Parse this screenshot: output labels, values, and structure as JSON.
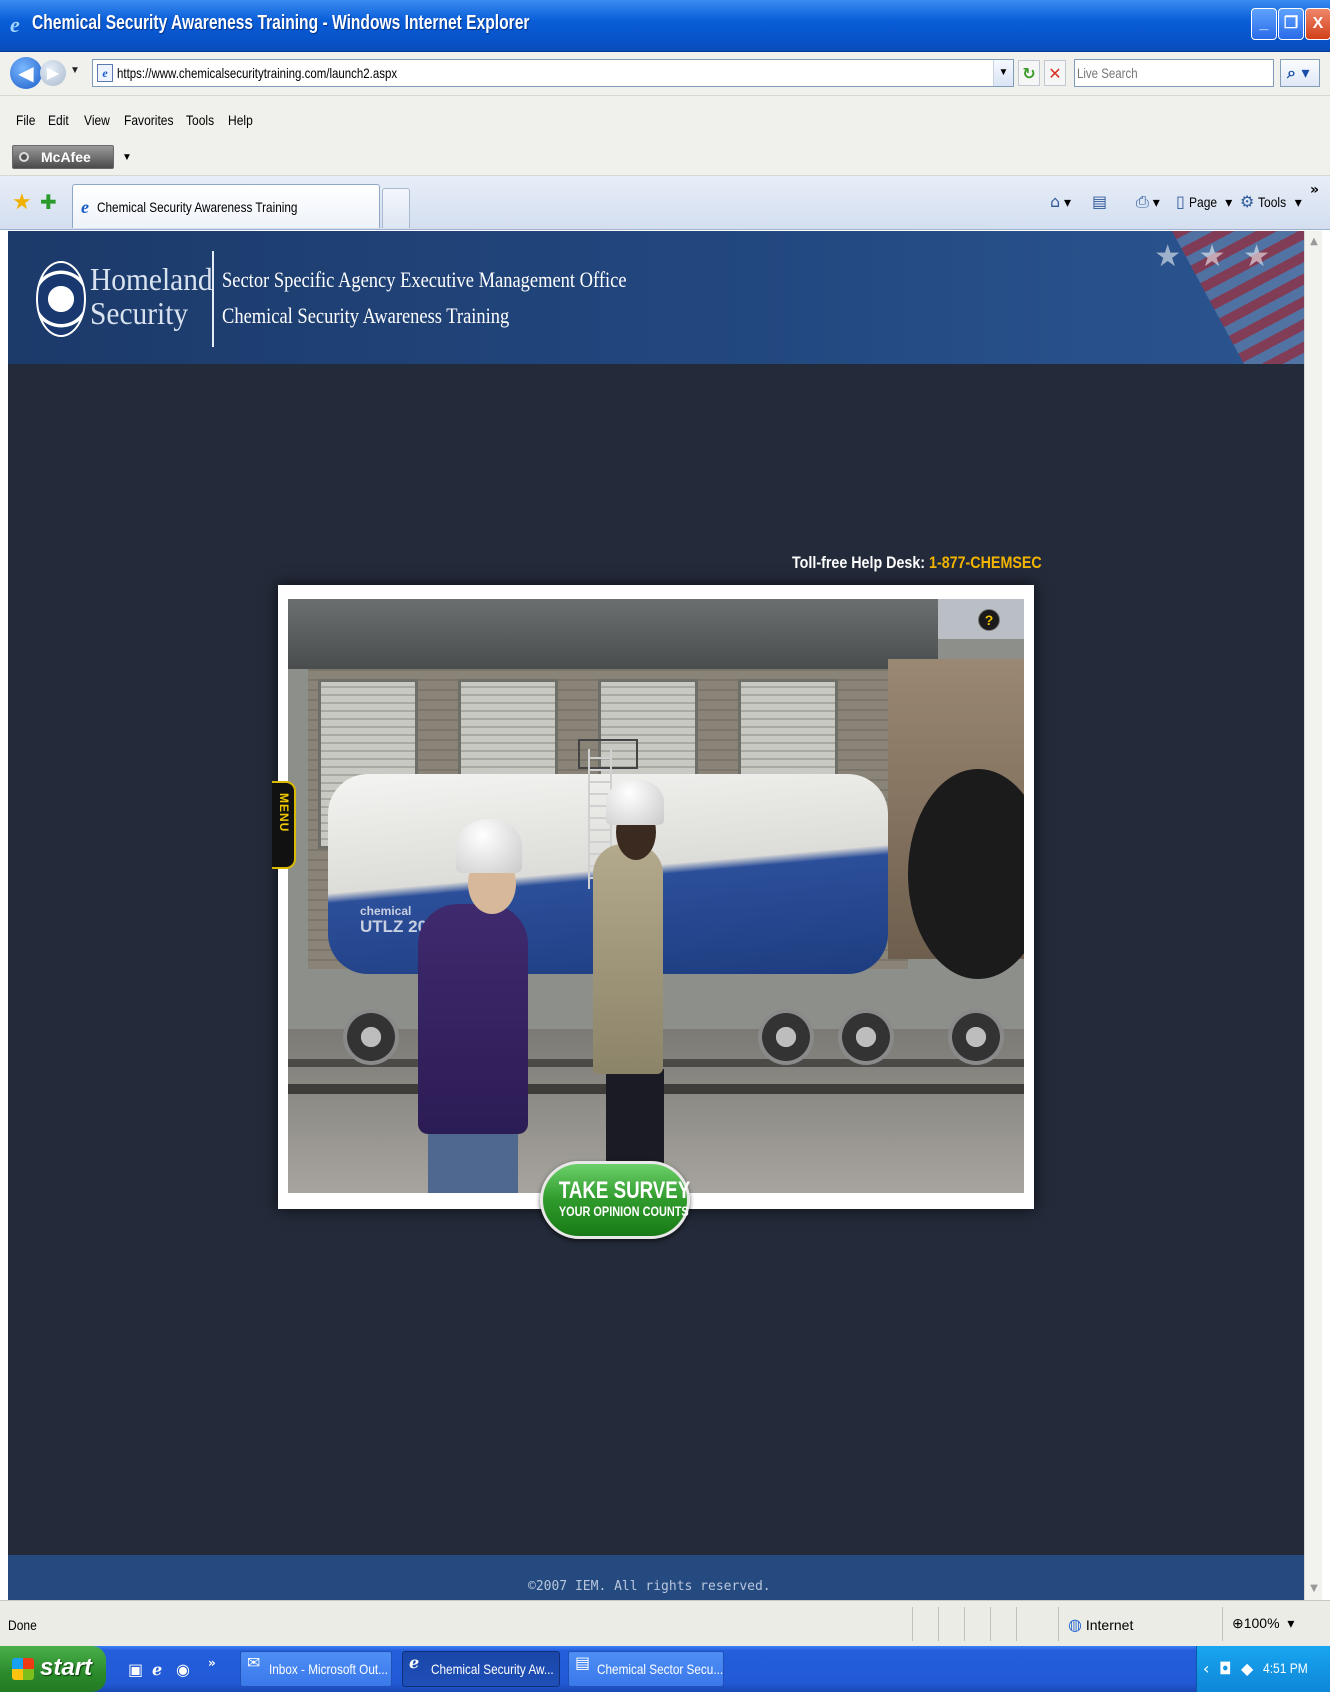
{
  "window": {
    "title": "Chemical Security Awareness Training - Windows Internet Explorer",
    "minimize": "_",
    "maximize": "❐",
    "close": "X"
  },
  "addressbar": {
    "url": "https://www.chemicalsecuritytraining.com/launch2.aspx",
    "search_placeholder": "Live Search"
  },
  "menubar": {
    "items": [
      "File",
      "Edit",
      "View",
      "Favorites",
      "Tools",
      "Help"
    ]
  },
  "mcafee": {
    "label": "McAfee"
  },
  "tabs": {
    "active_label": "Chemical Security Awareness Training"
  },
  "commandbar": {
    "page_label": "Page",
    "tools_label": "Tools"
  },
  "banner": {
    "agency_line1": "Homeland",
    "agency_line2": "Security",
    "office": "Sector Specific Agency Executive Management Office",
    "course": "Chemical Security Awareness Training"
  },
  "helpdesk": {
    "label": "Toll-free Help Desk:",
    "phone": "1-877-CHEMSEC"
  },
  "player": {
    "help_label": "?",
    "menu_label": "MENU",
    "tank_text1": "chemical",
    "tank_text2": "UTLZ 2007"
  },
  "survey": {
    "line1": "TAKE SURVEY",
    "line2": "YOUR OPINION COUNTS"
  },
  "footer": {
    "copyright": "©2007 IEM. All rights reserved."
  },
  "statusbar": {
    "status": "Done",
    "zone": "Internet",
    "zoom": "100%"
  },
  "taskbar": {
    "start_label": "start",
    "tasks": [
      {
        "label": "Inbox - Microsoft Out...",
        "active": false
      },
      {
        "label": "Chemical Security Aw...",
        "active": true
      },
      {
        "label": "Chemical Sector Secu...",
        "active": false
      }
    ],
    "clock": "4:51 PM"
  },
  "colors": {
    "page_bg": "#232a39",
    "banner_bg": "#22477f",
    "helpdesk_phone": "#f2b400",
    "survey_green": "#2f9a2c"
  },
  "icons": {
    "back": "back-arrow-icon",
    "forward": "forward-arrow-icon",
    "refresh": "refresh-icon",
    "stop": "stop-icon",
    "search": "search-icon",
    "favorites": "favorites-star-icon",
    "home": "home-icon",
    "feeds": "feeds-icon",
    "print": "print-icon",
    "internet": "globe-icon"
  }
}
